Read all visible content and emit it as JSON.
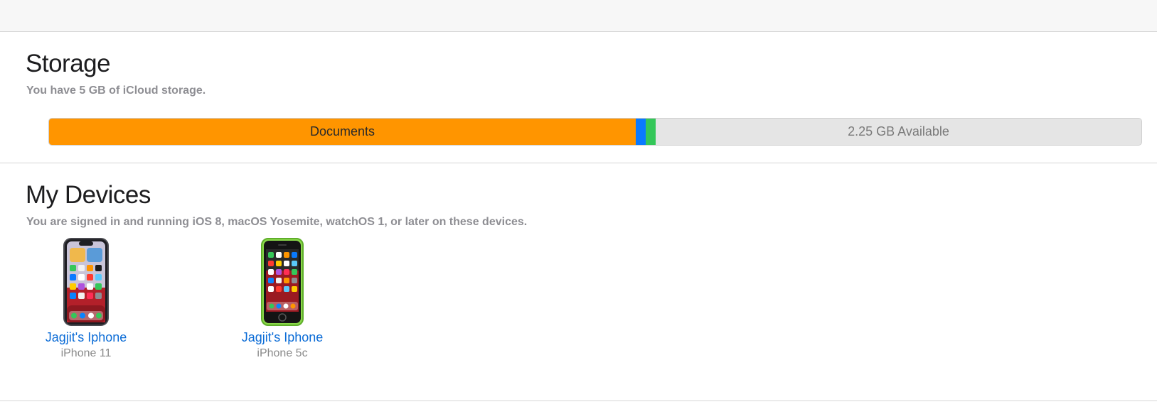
{
  "storage": {
    "title": "Storage",
    "subtitle": "You have 5 GB of iCloud storage.",
    "total_gb": 5,
    "used_gb": 2.75,
    "segments": [
      {
        "label": "Documents",
        "color": "#ff9500",
        "fraction_of_total": 0.536
      },
      {
        "label": "",
        "color": "#0a7aff",
        "fraction_of_total": 0.009
      },
      {
        "label": "",
        "color": "#34c759",
        "fraction_of_total": 0.009
      }
    ],
    "available_label": "2.25 GB Available",
    "available_color": "#e5e5e5"
  },
  "devices": {
    "title": "My Devices",
    "subtitle": "You are signed in and running iOS 8, macOS Yosemite, watchOS 1, or later on these devices.",
    "items": [
      {
        "name": "Jagjit's Iphone",
        "model": "iPhone 11",
        "icon": "iphone-11-icon"
      },
      {
        "name": "Jagjit's Iphone",
        "model": "iPhone 5c",
        "icon": "iphone-5c-icon"
      }
    ]
  },
  "colors": {
    "link": "#0a6bd6",
    "muted_text": "#8e8e93"
  }
}
